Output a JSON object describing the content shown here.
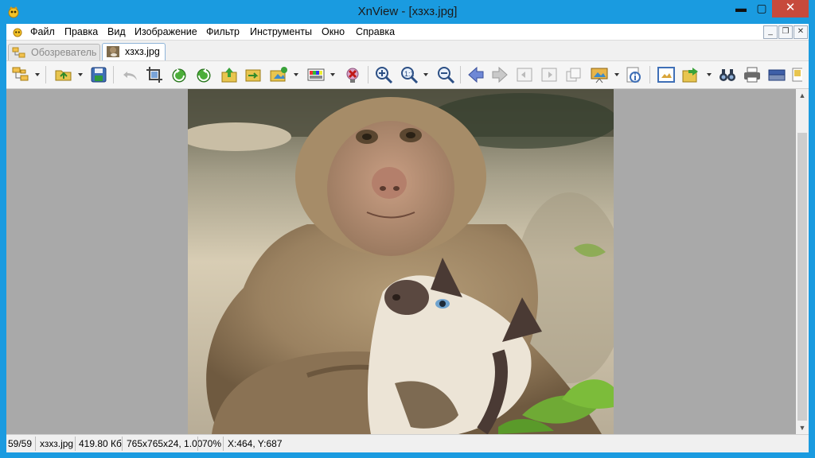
{
  "window": {
    "title": "XnView - [хзхз.jpg]",
    "min_symbol": "▭",
    "max_symbol": "▢",
    "close_symbol": "✕"
  },
  "menu": {
    "items": [
      "Файл",
      "Правка",
      "Вид",
      "Изображение",
      "Фильтр",
      "Инструменты",
      "Окно",
      "Справка"
    ],
    "mdi_min": "_",
    "mdi_restore": "❐",
    "mdi_close": "✕"
  },
  "tabs": [
    {
      "label": "Обозреватель",
      "active": false
    },
    {
      "label": "хзхз.jpg",
      "active": true
    }
  ],
  "toolbar": {
    "icons": [
      "browser-tree-icon",
      "open-folder-icon",
      "save-icon",
      "undo-icon",
      "crop-icon",
      "rotate-left-icon",
      "rotate-right-icon",
      "export-icon",
      "convert-icon",
      "change-folder-icon",
      "color-adjust-icon",
      "delete-icon",
      "zoom-in-icon",
      "zoom-icon",
      "zoom-out-icon",
      "prev-arrow-icon",
      "next-arrow-icon",
      "first-page-icon",
      "prev-page-icon",
      "next-page-icon",
      "slideshow-icon",
      "info-icon",
      "fullscreen-icon",
      "copy-to-icon",
      "search-binoculars-icon",
      "print-icon",
      "scan-icon"
    ]
  },
  "image": {
    "description_colors": {
      "sky": "#8a8470",
      "ground": "#d9cbb0",
      "fur": "#9c8564",
      "cat": "#eae3d7",
      "leaves": "#6faa35"
    }
  },
  "scrollbar": {
    "up": "▲",
    "down": "▼"
  },
  "status": {
    "index": "59/59",
    "filename": "хзхз.jpg",
    "filesize": "419.80 Кб",
    "dimensions": "765x765x24, 1.00",
    "zoom": "70%",
    "coords": "X:464, Y:687"
  }
}
